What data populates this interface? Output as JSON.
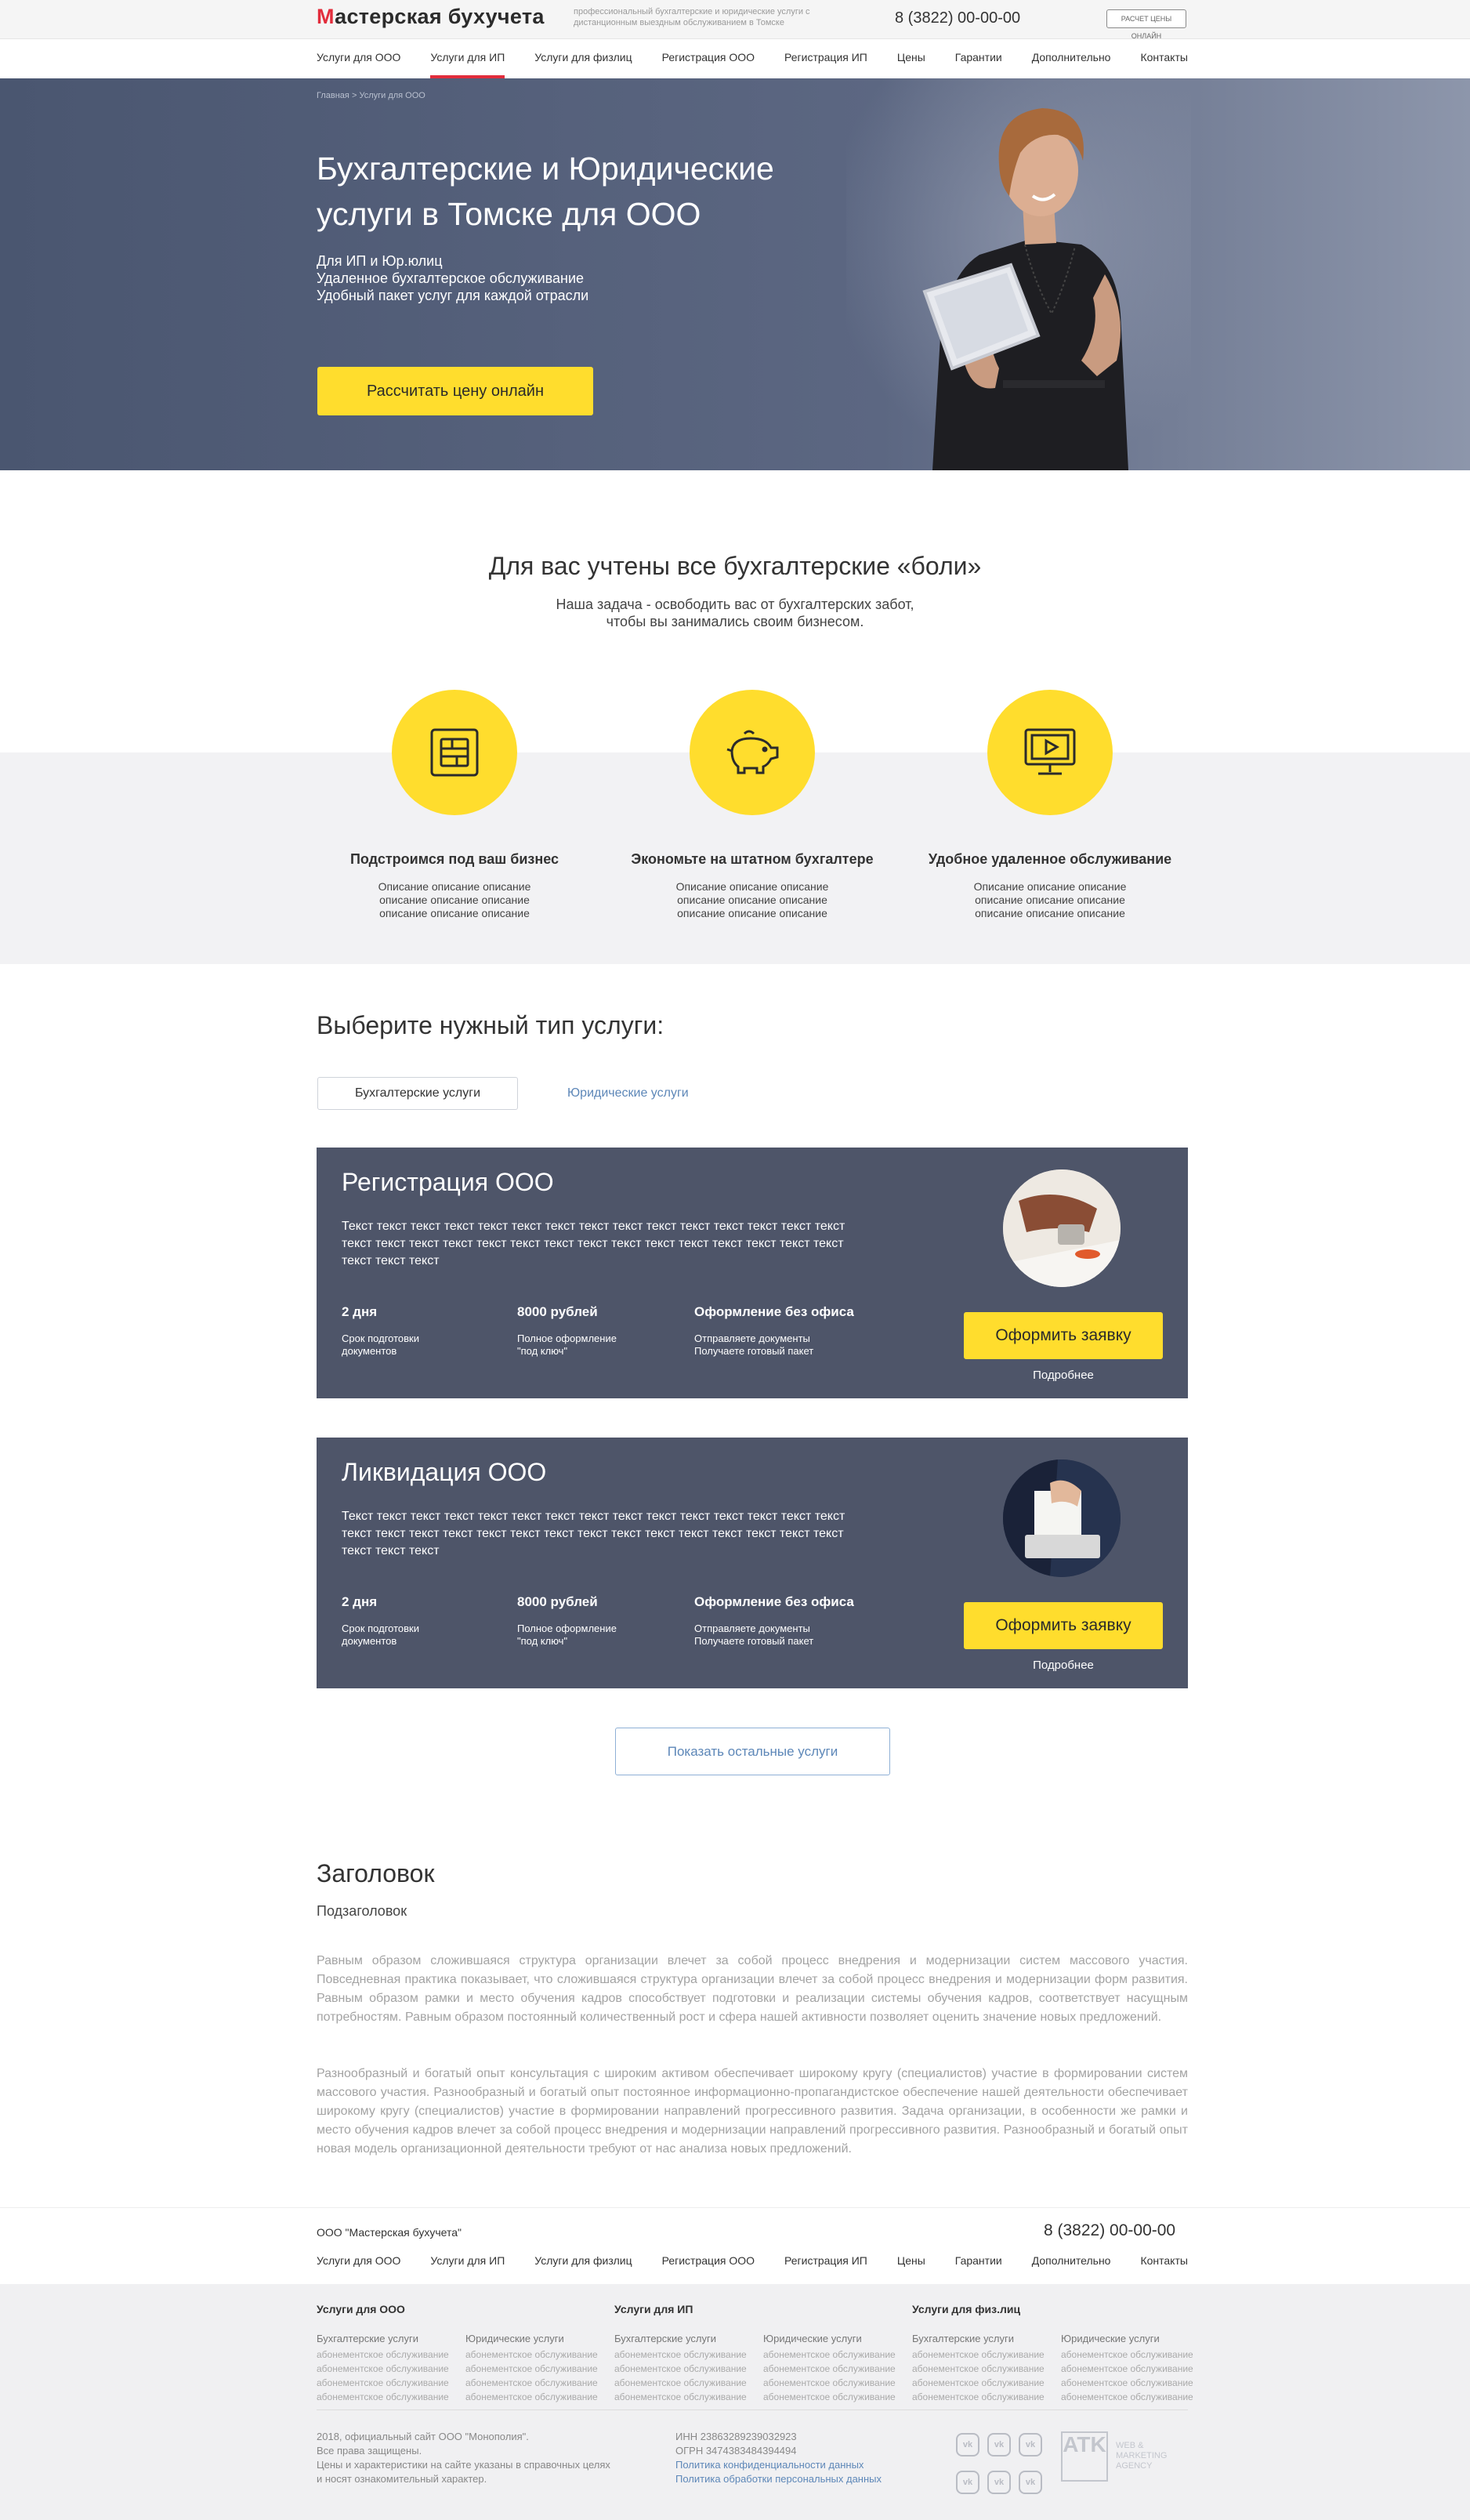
{
  "header": {
    "logo": "Мастерская бухучета",
    "logo_first_letter": "М",
    "logo_rest": "астерская бухучета",
    "tagline": "профессиональный бухгалтерские и юридические услуги с дистанционным выездным обслуживанием в Томске",
    "phone": "8 (3822) 00-00-00",
    "calc_button": "РАСЧЕТ ЦЕНЫ ОНЛАЙН"
  },
  "nav": [
    "Услуги для ООО",
    "Услуги для ИП",
    "Услуги для физлиц",
    "Регистрация ООО",
    "Регистрация ИП",
    "Цены",
    "Гарантии",
    "Дополнительно",
    "Контакты"
  ],
  "nav_active_index": 1,
  "hero": {
    "breadcrumb_home": "Главная",
    "breadcrumb_sep": ">",
    "breadcrumb_current": "Услуги для ООО",
    "title": "Бухгалтерские и Юридические услуги в Томске для ООО",
    "bullets": [
      "Для ИП и Юр.юлиц",
      "Удаленное бухгалтерское обслуживание",
      "Удобный пакет услуг для каждой отрасли"
    ],
    "button": "Рассчитать цену онлайн"
  },
  "pains": {
    "title": "Для вас учтены все бухгалтерские «боли»",
    "subtitle_line1": "Наша задача - освободить вас от бухгалтерских забот,",
    "subtitle_line2": "чтобы вы занимались своим бизнесом.",
    "features": [
      {
        "icon": "sim-card-icon",
        "title": "Подстроимся под ваш бизнес",
        "desc": [
          "Описание описание описание",
          "описание описание описание",
          "описание описание описание"
        ]
      },
      {
        "icon": "piggy-bank-icon",
        "title": "Экономьте на штатном бухгалтере",
        "desc": [
          "Описание описание описание",
          "описание описание описание",
          "описание описание описание"
        ]
      },
      {
        "icon": "monitor-icon",
        "title": "Удобное удаленное обслуживание",
        "desc": [
          "Описание описание описание",
          "описание описание описание",
          "описание описание описание"
        ]
      }
    ]
  },
  "services": {
    "title": "Выберите нужный тип услуги:",
    "tab_active": "Бухгалтерские услуги",
    "tab_inactive": "Юридические услуги",
    "cards": [
      {
        "title": "Регистрация ООО",
        "text": "Текст текст текст текст текст текст текст текст текст текст текст текст текст текст текст текст текст текст текст текст текст текст текст текст текст текст текст текст текст текст текст текст текст",
        "stats": [
          {
            "value": "2 дня",
            "label_1": "Срок подготовки",
            "label_2": "документов"
          },
          {
            "value": "8000 рублей",
            "label_1": "Полное оформление",
            "label_2": "\"под ключ\""
          },
          {
            "value": "Оформление без офиса",
            "label_1": "Отправляете документы",
            "label_2": "Получаете готовый пакет"
          }
        ],
        "button": "Оформить заявку",
        "more": "Подробнее"
      },
      {
        "title": "Ликвидация ООО",
        "text": "Текст текст текст текст текст текст текст текст текст текст текст текст текст текст текст текст текст текст текст текст текст текст текст текст текст текст текст текст текст текст текст текст текст",
        "stats": [
          {
            "value": "2 дня",
            "label_1": "Срок подготовки",
            "label_2": "документов"
          },
          {
            "value": "8000 рублей",
            "label_1": "Полное оформление",
            "label_2": "\"под ключ\""
          },
          {
            "value": "Оформление без офиса",
            "label_1": "Отправляете документы",
            "label_2": "Получаете готовый пакет"
          }
        ],
        "button": "Оформить заявку",
        "more": "Подробнее"
      }
    ],
    "show_more": "Показать остальные услуги"
  },
  "article": {
    "title": "Заголовок",
    "subtitle": "Подзаголовок",
    "p1": "Равным образом сложившаяся структура организации влечет за собой процесс внедрения и модернизации систем массового участия. Повседневная практика показывает, что сложившаяся структура организации влечет за собой процесс внедрения и модернизации форм развития. Равным образом рамки и место обучения кадров способствует подготовки и реализации системы обучения кадров, соответствует насущным потребностям. Равным образом постоянный количественный рост и сфера нашей активности позволяет оценить значение новых предложений.",
    "p2": "Разнообразный и богатый опыт консультация с широким активом обеспечивает широкому кругу (специалистов) участие в формировании систем массового участия. Разнообразный и богатый опыт постоянное информационно-пропагандистское обеспечение нашей деятельности обеспечивает широкому кругу (специалистов) участие в формировании направлений прогрессивного развития. Задача организации, в особенности же рамки и место обучения кадров влечет за собой процесс внедрения и модернизации направлений прогрессивного развития. Разнообразный и богатый опыт новая модель организационной деятельности требуют от нас анализа новых предложений."
  },
  "footer": {
    "company": "ООО \"Мастерская бухучета\"",
    "phone": "8 (3822) 00-00-00",
    "nav": [
      "Услуги для ООО",
      "Услуги для ИП",
      "Услуги для физлиц",
      "Регистрация ООО",
      "Регистрация ИП",
      "Цены",
      "Гарантии",
      "Дополнительно",
      "Контакты"
    ],
    "columns": [
      {
        "heading": "Услуги для ООО",
        "sub": [
          {
            "title": "Бухгалтерские услуги",
            "items": [
              "абонементское обслуживание",
              "абонементское обслуживание",
              "абонементское обслуживание",
              "абонементское обслуживание"
            ]
          },
          {
            "title": "Юридические услуги",
            "items": [
              "абонементское обслуживание",
              "абонементское обслуживание",
              "абонементское обслуживание",
              "абонементское обслуживание"
            ]
          }
        ]
      },
      {
        "heading": "Услуги для ИП",
        "sub": [
          {
            "title": "Бухгалтерские услуги",
            "items": [
              "абонементское обслуживание",
              "абонементское обслуживание",
              "абонементское обслуживание",
              "абонементское обслуживание"
            ]
          },
          {
            "title": "Юридические услуги",
            "items": [
              "абонементское обслуживание",
              "абонементское обслуживание",
              "абонементское обслуживание",
              "абонементское обслуживание"
            ]
          }
        ]
      },
      {
        "heading": "Услуги для физ.лиц",
        "sub": [
          {
            "title": "Бухгалтерские услуги",
            "items": [
              "абонементское обслуживание",
              "абонементское обслуживание",
              "абонементское обслуживание",
              "абонементское обслуживание"
            ]
          },
          {
            "title": "Юридические услуги",
            "items": [
              "абонементское обслуживание",
              "абонементское обслуживание",
              "абонементское обслуживание",
              "абонементское обслуживание"
            ]
          }
        ]
      }
    ],
    "copyright": [
      "2018, официальный сайт ООО \"Монополия\".",
      "Все права защищены.",
      "Цены и характеристики на сайте указаны в справочных целях",
      "и носят ознакомительный характер."
    ],
    "inn": "ИНН 23863289239032923",
    "ogrn": "ОГРН 3474383484394494",
    "privacy_link": "Политика конфиденциальности данных",
    "data_link": "Политика обработки персональных данных",
    "social_label": "vk",
    "agency_logo": "ATK",
    "agency_text": [
      "WEB &",
      "MARKETING",
      "AGENCY"
    ]
  },
  "colors": {
    "accent_yellow": "#ffdd2d",
    "brand_red": "#e22d3c",
    "hero_bg": "#4e5771",
    "card_bg": "#4e5569",
    "link_blue": "#5d87b8"
  }
}
